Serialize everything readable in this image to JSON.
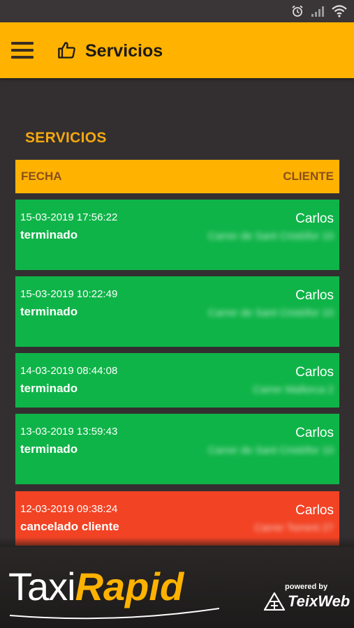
{
  "header": {
    "title": "Servicios"
  },
  "section": {
    "title": "SERVICIOS"
  },
  "table": {
    "col_date": "FECHA",
    "col_client": "CLIENTE"
  },
  "services": [
    {
      "date": "15-03-2019 17:56:22",
      "status": "terminado",
      "client": "Carlos",
      "address": "Carrer de Sant Cristòfor 10",
      "color": "#0fb448"
    },
    {
      "date": "15-03-2019 10:22:49",
      "status": "terminado",
      "client": "Carlos",
      "address": "Carrer de Sant Cristòfor 10",
      "color": "#0fb448"
    },
    {
      "date": "14-03-2019 08:44:08",
      "status": "terminado",
      "client": "Carlos",
      "address": "Carrer Mallorca 2",
      "color": "#0fb448"
    },
    {
      "date": "13-03-2019 13:59:43",
      "status": "terminado",
      "client": "Carlos",
      "address": "Carrer de Sant Cristòfor 10",
      "color": "#0fb448"
    },
    {
      "date": "12-03-2019 09:38:24",
      "status": "cancelado cliente",
      "client": "Carlos",
      "address": "Carrer Torrent 27",
      "color": "#f24324"
    }
  ],
  "footer": {
    "logo_taxi": "Taxi",
    "logo_rapid": "Rapid",
    "powered_by": "powered by",
    "brand": "TeixWeb"
  },
  "icons": {
    "menu": "menu-icon",
    "thumb": "thumbs-up-icon",
    "alarm": "alarm-icon",
    "signal": "signal-icon",
    "wifi": "wifi-icon"
  },
  "colors": {
    "accent": "#ffb300",
    "background": "#332f30",
    "done": "#0fb448",
    "cancelled": "#f24324"
  }
}
